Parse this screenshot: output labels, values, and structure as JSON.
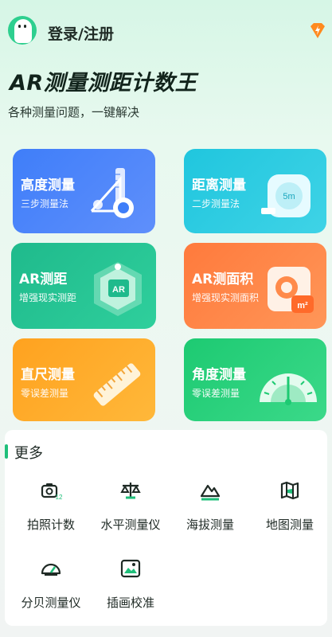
{
  "header": {
    "login_label": "登录/注册",
    "avatar_icon": "mascot-avatar",
    "vip_icon": "lightning-badge-icon"
  },
  "hero": {
    "title": "AR测量测距计数王",
    "subtitle": "各种测量问题，一键解决"
  },
  "cards": [
    {
      "title": "高度测量",
      "subtitle": "三步测量法",
      "icon": "height-measure-icon",
      "color": "#3f7ef9"
    },
    {
      "title": "距离测量",
      "subtitle": "二步测量法",
      "icon": "tape-measure-icon",
      "color": "#20c6de",
      "icon_text": "5m"
    },
    {
      "title": "AR测距",
      "subtitle": "增强现实测距",
      "icon": "ar-cube-icon",
      "color": "#1fba8c",
      "icon_text": "AR"
    },
    {
      "title": "AR测面积",
      "subtitle": "增强现实测面积",
      "icon": "area-camera-icon",
      "color": "#ff7a3c",
      "icon_text": "m²"
    },
    {
      "title": "直尺测量",
      "subtitle": "零误差测量",
      "icon": "ruler-icon",
      "color": "#ffa21f"
    },
    {
      "title": "角度测量",
      "subtitle": "零误差测量",
      "icon": "protractor-icon",
      "color": "#1dca72"
    }
  ],
  "more": {
    "title": "更多",
    "tools": [
      {
        "label": "拍照计数",
        "icon": "camera-count-icon",
        "icon_text": "12"
      },
      {
        "label": "水平测量仪",
        "icon": "level-icon"
      },
      {
        "label": "海拔测量",
        "icon": "mountain-icon"
      },
      {
        "label": "地图测量",
        "icon": "map-icon"
      },
      {
        "label": "分贝测量仪",
        "icon": "decibel-gauge-icon"
      },
      {
        "label": "插画校准",
        "icon": "image-calibrate-icon"
      }
    ]
  },
  "colors": {
    "accent": "#1fbf7a",
    "vip": "#ff8a1f"
  }
}
